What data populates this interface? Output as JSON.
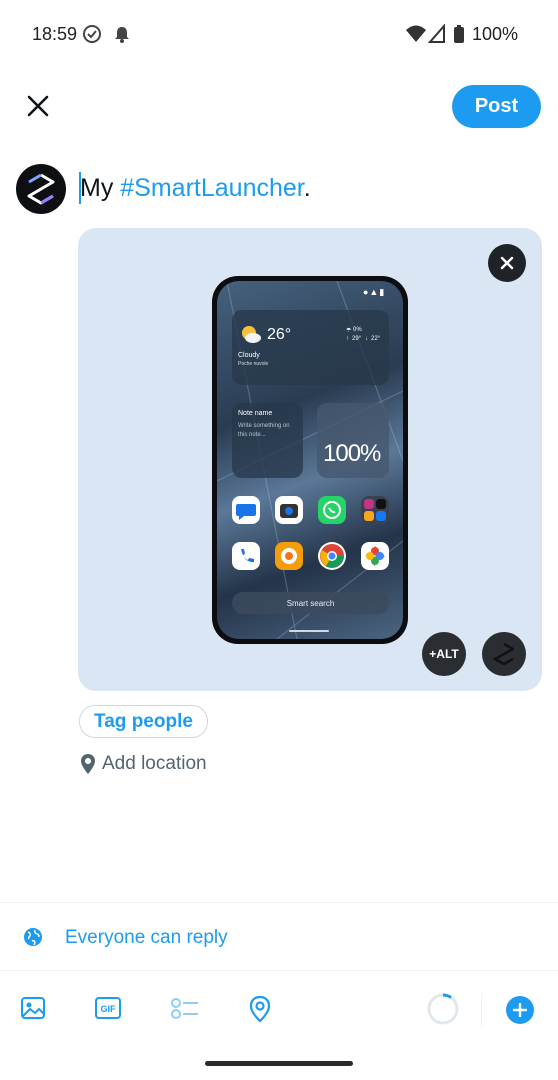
{
  "status_bar": {
    "time": "18:59",
    "battery": "100%"
  },
  "header": {
    "post_label": "Post"
  },
  "composer": {
    "text_plain": "My ",
    "hashtag": "#SmartLauncher",
    "text_end": "."
  },
  "media": {
    "alt_label": "+ALT",
    "phone": {
      "temperature": "26°",
      "condition": "Cloudy",
      "condition_sub": "Poche nuvole",
      "precip": "0%",
      "high": "29°",
      "low": "22°",
      "note_title": "Note name",
      "note_body": "Write something on this note...",
      "battery_widget": "100%",
      "search_label": "Smart search"
    }
  },
  "actions": {
    "tag_people": "Tag people",
    "add_location": "Add location"
  },
  "reply": {
    "label": "Everyone can reply"
  },
  "colors": {
    "accent": "#1d9bf0",
    "text": "#0f1419",
    "muted": "#536471",
    "media_bg": "#dbe6f4"
  }
}
